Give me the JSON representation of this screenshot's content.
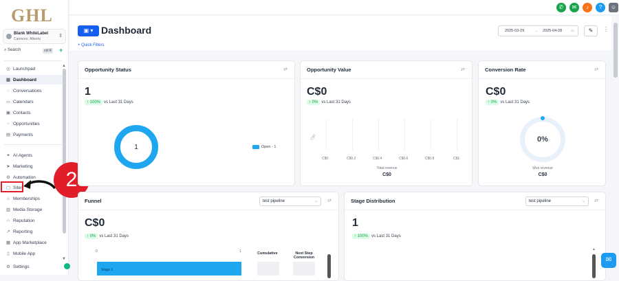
{
  "brand": {
    "logo_text": "GHL"
  },
  "account": {
    "name": "Blank WhiteLabel",
    "location": "Canmore, Alberta"
  },
  "search": {
    "label": "Search",
    "shortcut": "ctrl K"
  },
  "sidebar": {
    "items": [
      {
        "label": "Launchpad",
        "icon": "rocket-icon"
      },
      {
        "label": "Dashboard",
        "icon": "grid-icon"
      },
      {
        "label": "Conversations",
        "icon": "chat-icon"
      },
      {
        "label": "Calendars",
        "icon": "calendar-icon"
      },
      {
        "label": "Contacts",
        "icon": "contacts-icon"
      },
      {
        "label": "Opportunities",
        "icon": "opportunities-icon"
      },
      {
        "label": "Payments",
        "icon": "payments-icon"
      },
      {
        "label": "AI Agents",
        "icon": "ai-icon"
      },
      {
        "label": "Marketing",
        "icon": "send-icon"
      },
      {
        "label": "Automation",
        "icon": "automation-icon"
      },
      {
        "label": "Sites",
        "icon": "sites-icon"
      },
      {
        "label": "Memberships",
        "icon": "memberships-icon"
      },
      {
        "label": "Media Storage",
        "icon": "media-icon"
      },
      {
        "label": "Reputation",
        "icon": "star-icon"
      },
      {
        "label": "Reporting",
        "icon": "chart-icon"
      },
      {
        "label": "App Marketplace",
        "icon": "marketplace-icon"
      },
      {
        "label": "Mobile App",
        "icon": "mobile-icon"
      },
      {
        "label": "Settings",
        "icon": "gear-icon"
      }
    ],
    "active": "Dashboard"
  },
  "annotation": {
    "step_number": "2"
  },
  "header": {
    "title": "Dashboard",
    "quick_filters": "Quick Filters",
    "date_start": "2025-03-29",
    "date_arrow": "→",
    "date_end": "2025-04-28"
  },
  "cards": {
    "opportunity_status": {
      "title": "Opportunity Status",
      "value": "1",
      "change": "↑ 100%",
      "vs": "vs Last 31 Days",
      "donut_value": "1",
      "legend": "Open - 1"
    },
    "opportunity_value": {
      "title": "Opportunity Value",
      "value": "C$0",
      "change": "↑ 0%",
      "vs": "vs Last 31 Days",
      "y_label": "C$0",
      "ticks": [
        "C$0",
        "C$0.2",
        "C$0.4",
        "C$0.6",
        "C$0.8",
        "C$1"
      ],
      "xlabel": "Total revenue",
      "total": "C$0"
    },
    "conversion_rate": {
      "title": "Conversion Rate",
      "value": "C$0",
      "change": "↑ 0%",
      "vs": "vs Last 31 Days",
      "gauge_value": "0%",
      "caption": "Won revenue",
      "total": "C$0"
    },
    "funnel": {
      "title": "Funnel",
      "pipeline": "test pipeline",
      "value": "C$0",
      "change": "↑ 0%",
      "vs": "vs Last 31 Days",
      "axis_start": "0",
      "axis_end": "1",
      "col1": "Cumulative",
      "col2": "Next Step Conversion",
      "stage": "Stage 1"
    },
    "stage_distribution": {
      "title": "Stage Distribution",
      "pipeline": "test pipeline",
      "value": "1",
      "change": "↑ 100%",
      "vs": "vs Last 31 Days"
    }
  },
  "colors": {
    "accent": "#155eef",
    "chart": "#1fa6f0",
    "alert": "#e11d2a"
  }
}
